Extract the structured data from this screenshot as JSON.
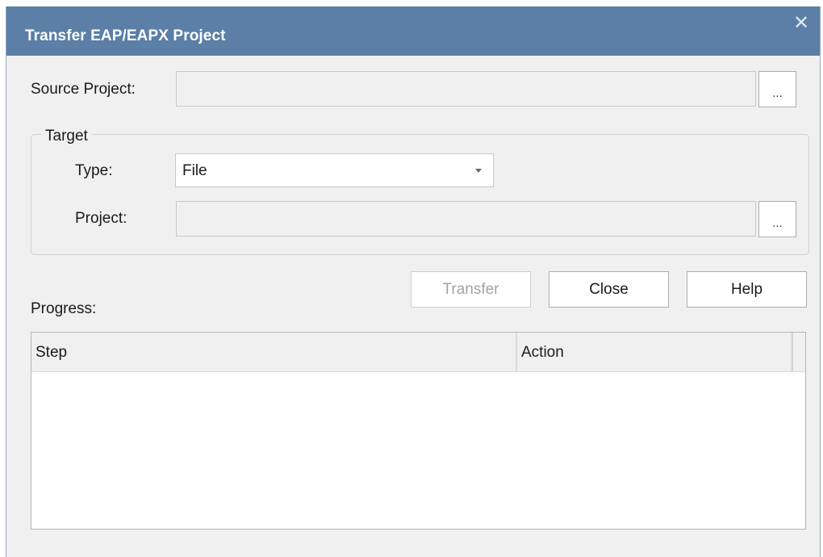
{
  "dialog": {
    "title": "Transfer EAP/EAPX Project",
    "close_glyph": "✕"
  },
  "source": {
    "label": "Source Project:",
    "value": "",
    "browse_label": "..."
  },
  "target": {
    "legend": "Target",
    "type_label": "Type:",
    "type_value": "File",
    "project_label": "Project:",
    "project_value": "",
    "browse_label": "..."
  },
  "buttons": {
    "transfer": "Transfer",
    "close": "Close",
    "help": "Help"
  },
  "progress": {
    "label": "Progress:",
    "columns": [
      "Step",
      "Action"
    ],
    "rows": []
  },
  "icons": {
    "close": "close-icon",
    "dropdown": "chevron-down-icon"
  }
}
